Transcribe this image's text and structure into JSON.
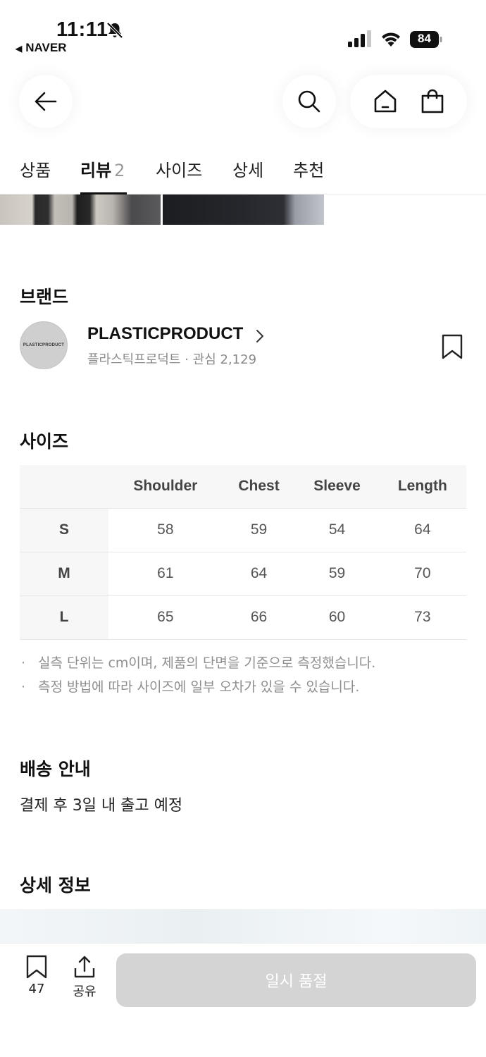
{
  "status_bar": {
    "time": "11:11",
    "back_app": "NAVER",
    "battery": "84"
  },
  "nav": {
    "back_icon": "arrow-left-icon",
    "search_icon": "search-icon",
    "home_icon": "home-icon",
    "cart_icon": "shopping-bag-icon"
  },
  "tabs": [
    {
      "label": "상품"
    },
    {
      "label": "리뷰",
      "count": "2",
      "active": true
    },
    {
      "label": "사이즈"
    },
    {
      "label": "상세"
    },
    {
      "label": "추천"
    }
  ],
  "brand": {
    "section_title": "브랜드",
    "logo_text": "PLASTICPRODUCT",
    "name": "PLASTICPRODUCT",
    "subtitle": "플라스틱프로덕트 · 관심 2,129"
  },
  "size": {
    "section_title": "사이즈",
    "columns": [
      "Shoulder",
      "Chest",
      "Sleeve",
      "Length"
    ],
    "rows": [
      {
        "label": "S",
        "values": [
          "58",
          "59",
          "54",
          "64"
        ]
      },
      {
        "label": "M",
        "values": [
          "61",
          "64",
          "59",
          "70"
        ]
      },
      {
        "label": "L",
        "values": [
          "65",
          "66",
          "60",
          "73"
        ]
      }
    ],
    "notes": [
      "실측 단위는 cm이며, 제품의 단면을 기준으로 측정했습니다.",
      "측정 방법에 따라 사이즈에 일부 오차가 있을 수 있습니다."
    ]
  },
  "shipping": {
    "section_title": "배송 안내",
    "text": "결제 후 3일 내 출고 예정"
  },
  "detail": {
    "section_title": "상세 정보"
  },
  "bottom_bar": {
    "bookmark_count": "47",
    "share_label": "공유",
    "soldout_label": "일시 품절"
  }
}
